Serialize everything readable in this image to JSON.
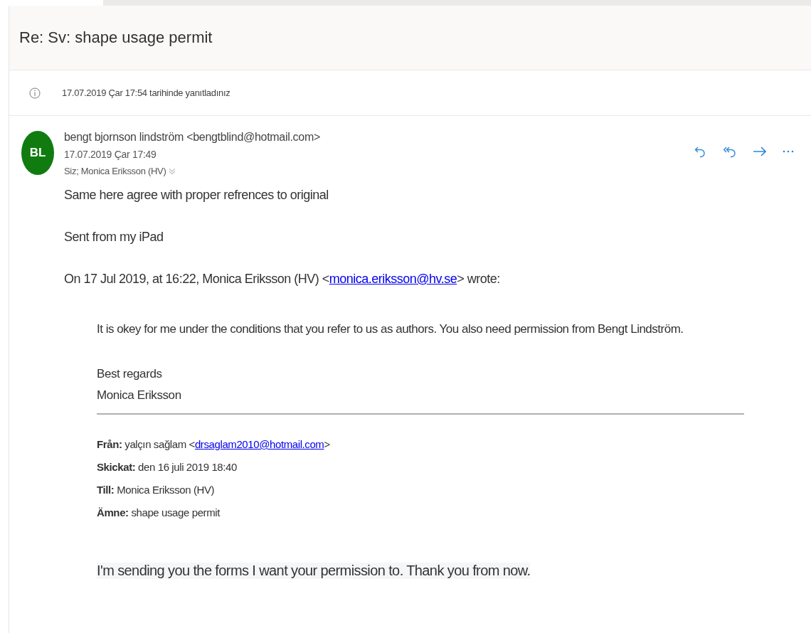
{
  "subject": "Re: Sv: shape usage permit",
  "info_banner": "17.07.2019 Çar 17:54 tarihinde yanıtladınız",
  "message": {
    "avatar_initials": "BL",
    "sender": "bengt bjornson lindström <bengtblind@hotmail.com>",
    "date": "17.07.2019 Çar 17:49",
    "recipients": "Siz; Monica Eriksson (HV)",
    "actions": [
      {
        "kind": "reply"
      },
      {
        "kind": "reply-all"
      },
      {
        "kind": "forward"
      },
      {
        "kind": "more"
      }
    ],
    "body": [
      "Same here agree with proper refrences to original",
      "Sent from my iPad"
    ],
    "quote_intro": {
      "before": "On 17 Jul 2019, at 16:22, Monica Eriksson (HV) <",
      "link": "monica.eriksson@hv.se",
      "after": "> wrote:"
    },
    "quote": {
      "paragraphs": [
        "It is okey for me under the conditions that you refer to us as authors. You also need permission from Bengt Lindström."
      ],
      "signature": [
        "Best regards",
        "Monica Eriksson"
      ],
      "headers": [
        {
          "label": "Från:",
          "value": "yalçın sağlam <",
          "link": "drsaglam2010@hotmail.com",
          "after": ">"
        },
        {
          "label": "Skickat:",
          "value": "den 16 juli 2019 18:40"
        },
        {
          "label": "Till:",
          "value": "Monica Eriksson (HV)"
        },
        {
          "label": "Ämne:",
          "value": "shape usage permit"
        }
      ],
      "original_text": "I'm sending you the forms I want your permission to. Thank you from now."
    }
  }
}
